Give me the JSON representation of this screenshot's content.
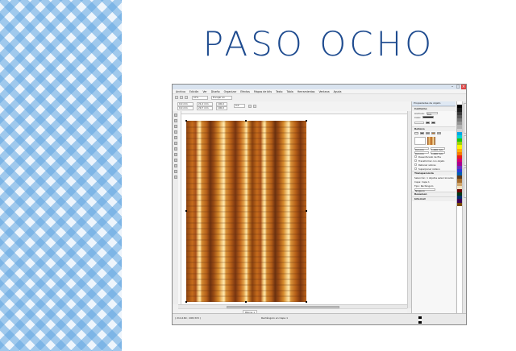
{
  "heading": "PASO OCHO",
  "app": {
    "menu": [
      "Archivo",
      "Edición",
      "Ver",
      "Diseño",
      "Organizar",
      "Efectos",
      "Mapas de bits",
      "Texto",
      "Tabla",
      "Herramientas",
      "Ventana",
      "Ayuda"
    ],
    "zoom": "57%",
    "snap_label": "Encajar en",
    "prop_x": "0,0 mm",
    "prop_y": "0,0 mm",
    "prop_w": "21,0 mm",
    "prop_h": "29,7 mm",
    "prop_scale_w": "100,0",
    "prop_scale_h": "100,0",
    "rotation": "0,0",
    "page_tab": "Página 1",
    "status_left": "Rectángulo en Capa 1",
    "status_coords": "( 214,160 ; 208,315 )"
  },
  "docker": {
    "title": "Propiedades de objeto",
    "sections": {
      "outline": "Contorno",
      "fill": "Relleno",
      "transparency": "Transparencia",
      "summary": "Resumen",
      "internet": "Internet"
    },
    "outline_width": "Pelo",
    "outline_color_label": "Color:",
    "width_label": "Anchura:",
    "fill_values": [
      "0,0 mm",
      "0,0 mm",
      "1.000 mm",
      "1.000 mm"
    ],
    "checks": [
      "Desenfocado de fila",
      "Transformar con objeto",
      "Rellenar sobres",
      "Superponer relleno"
    ],
    "summary_lines": [
      "Selección: 1 objetos seleccionados",
      "Capa: Capa 1",
      "Tipo: Rectángulo"
    ],
    "layer_label": "Ninguno"
  },
  "palette_colors": [
    "#ffffff",
    "#000000",
    "#1c1c1c",
    "#3a3a3a",
    "#575757",
    "#757575",
    "#939393",
    "#b1b1b1",
    "#cfcfcf",
    "#00a6e8",
    "#00d4d4",
    "#1fc40f",
    "#9cd600",
    "#fff200",
    "#ffb000",
    "#f57a00",
    "#e81b1b",
    "#d6006e",
    "#a8008f",
    "#6b2cc2",
    "#2a3bd6",
    "#005fb3",
    "#5e3a1a",
    "#a36b2b",
    "#d1a66b",
    "#f1e2bf",
    "#6a0000",
    "#003a12",
    "#002b6b",
    "#3b0056",
    "#7a4a00",
    "#ffffff"
  ]
}
